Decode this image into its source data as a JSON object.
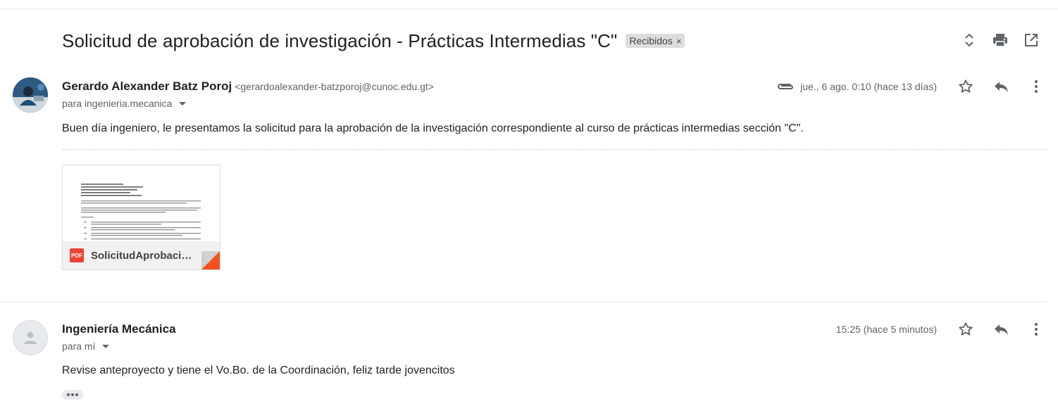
{
  "thread": {
    "subject": "Solicitud de aprobación de investigación - Prácticas Intermedias \"C\"",
    "label": "Recibidos",
    "label_remove": "×"
  },
  "toolbar": {
    "expand_icon": "unfold-icon",
    "print_icon": "print-icon",
    "open_new_window_icon": "open-in-new-icon"
  },
  "messages": [
    {
      "sender_name": "Gerardo Alexander Batz Poroj",
      "sender_email": "<gerardoalexander-batzporoj@cunoc.edu.gt>",
      "to": "para ingenieria.mecanica",
      "date": "jue., 6 ago. 0:10 (hace 13 días)",
      "has_attachment": true,
      "body": "Buen día ingeniero, le presentamos la solicitud para la aprobación de la investigación correspondiente al curso de prácticas intermedias sección \"C\".",
      "attachment": {
        "type": "PDF",
        "name": "SolicitudAprobació..."
      }
    },
    {
      "sender_name": "Ingeniería Mecánica",
      "to": "para mí",
      "date": "15:25 (hace 5 minutos)",
      "body": "Revise  anteproyecto y tiene el Vo.Bo. de la Coordinación, feliz tarde jovencitos"
    }
  ],
  "colors": {
    "text": "#202124",
    "secondary": "#5f6368",
    "pdf_red": "#ea4335",
    "fold_orange": "#f4511e",
    "chip_bg": "#dddddd"
  }
}
